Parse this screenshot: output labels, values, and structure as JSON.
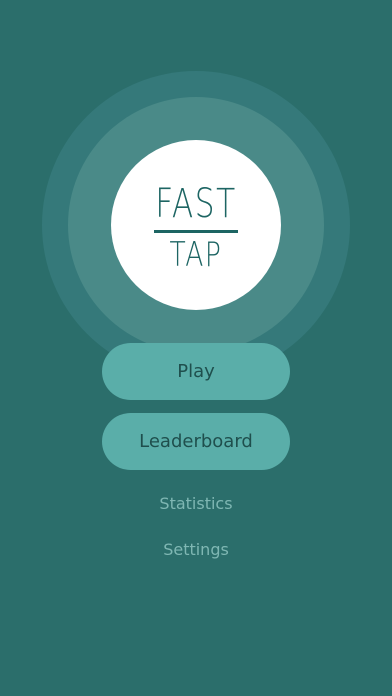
{
  "logo": {
    "line1": "FAST",
    "line2": "TAP"
  },
  "menu": {
    "play_label": "Play",
    "leaderboard_label": "Leaderboard",
    "statistics_label": "Statistics",
    "settings_label": "Settings"
  },
  "colors": {
    "background": "#2b6e6b",
    "button": "#5aaea9",
    "logo_text": "#1d6563",
    "link_text": "#7fb7b3"
  }
}
